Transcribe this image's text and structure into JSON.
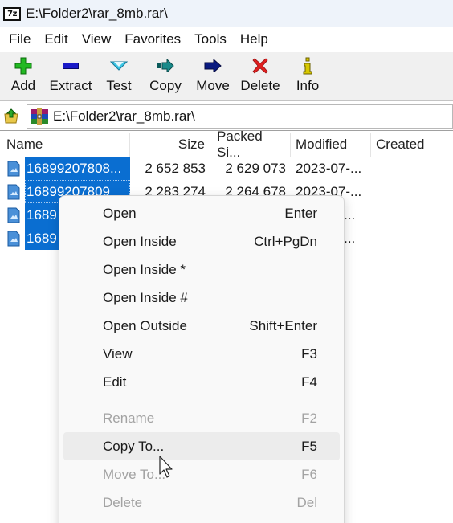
{
  "window": {
    "app_icon_text": "7z",
    "title": "E:\\Folder2\\rar_8mb.rar\\"
  },
  "menubar": {
    "items": [
      "File",
      "Edit",
      "View",
      "Favorites",
      "Tools",
      "Help"
    ]
  },
  "toolbar": {
    "buttons": [
      {
        "label": "Add",
        "icon": "plus-icon",
        "color": "#22b922"
      },
      {
        "label": "Extract",
        "icon": "minus-icon",
        "color": "#1a1ac8"
      },
      {
        "label": "Test",
        "icon": "check-chevron-icon",
        "color": "#3cc8e6"
      },
      {
        "label": "Copy",
        "icon": "copy-arrow-icon",
        "color": "#1a8a8a"
      },
      {
        "label": "Move",
        "icon": "move-arrow-icon",
        "color": "#0a1a80"
      },
      {
        "label": "Delete",
        "icon": "x-icon",
        "color": "#e02020"
      },
      {
        "label": "Info",
        "icon": "info-icon",
        "color": "#d8c800"
      }
    ]
  },
  "addressbar": {
    "path": "E:\\Folder2\\rar_8mb.rar\\"
  },
  "file_list": {
    "columns": [
      "Name",
      "Size",
      "Packed Si...",
      "Modified",
      "Created"
    ],
    "rows": [
      {
        "name": "16899207808...",
        "size": "2 652 853",
        "packed": "2 629 073",
        "modified": "2023-07-...",
        "created": ""
      },
      {
        "name": "16899207809",
        "size": "2 283 274",
        "packed": "2 264 678",
        "modified": "2023-07-...",
        "created": ""
      },
      {
        "name": "1689",
        "size": "",
        "packed": "",
        "modified": "7-...",
        "created": ""
      },
      {
        "name": "1689",
        "size": "",
        "packed": "",
        "modified": "7-...",
        "created": ""
      }
    ],
    "selection_color": "#0a6ed1"
  },
  "context_menu": {
    "items": [
      {
        "label": "Open",
        "shortcut": "Enter",
        "disabled": false
      },
      {
        "label": "Open Inside",
        "shortcut": "Ctrl+PgDn",
        "disabled": false
      },
      {
        "label": "Open Inside *",
        "shortcut": "",
        "disabled": false
      },
      {
        "label": "Open Inside #",
        "shortcut": "",
        "disabled": false
      },
      {
        "label": "Open Outside",
        "shortcut": "Shift+Enter",
        "disabled": false
      },
      {
        "label": "View",
        "shortcut": "F3",
        "disabled": false
      },
      {
        "label": "Edit",
        "shortcut": "F4",
        "disabled": false
      },
      {
        "label": "Rename",
        "shortcut": "F2",
        "disabled": true
      },
      {
        "label": "Copy To...",
        "shortcut": "F5",
        "disabled": false,
        "hovered": true
      },
      {
        "label": "Move To...",
        "shortcut": "F6",
        "disabled": true
      },
      {
        "label": "Delete",
        "shortcut": "Del",
        "disabled": true
      }
    ]
  }
}
